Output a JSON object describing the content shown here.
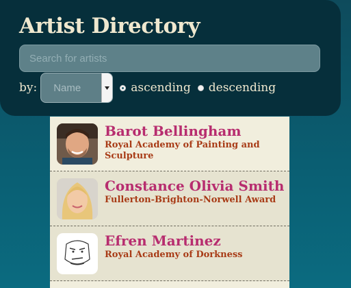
{
  "header": {
    "title": "Artist Directory",
    "search_placeholder": "Search for artists",
    "sort_label": "by:",
    "sort_value": "Name",
    "order_options": [
      {
        "label": "ascending",
        "checked": true
      },
      {
        "label": "descending",
        "checked": false
      }
    ]
  },
  "artists": [
    {
      "name": "Barot Bellingham",
      "award": "Royal Academy of Painting and Sculpture",
      "photo": "man-with-beard-photo"
    },
    {
      "name": "Constance Olivia Smith",
      "award": "Fullerton-Brighton-Norwell Award",
      "photo": "blonde-woman-photo"
    },
    {
      "name": "Efren Martinez",
      "award": "Royal Academy of Dorkness",
      "photo": "meme-face-drawing"
    }
  ],
  "colors": {
    "background": "#0a5f73",
    "panel": "#062f3b",
    "list_background": "#f1eedd",
    "name": "#b72d6f",
    "award": "#a83b16",
    "title": "#efe8cf"
  }
}
